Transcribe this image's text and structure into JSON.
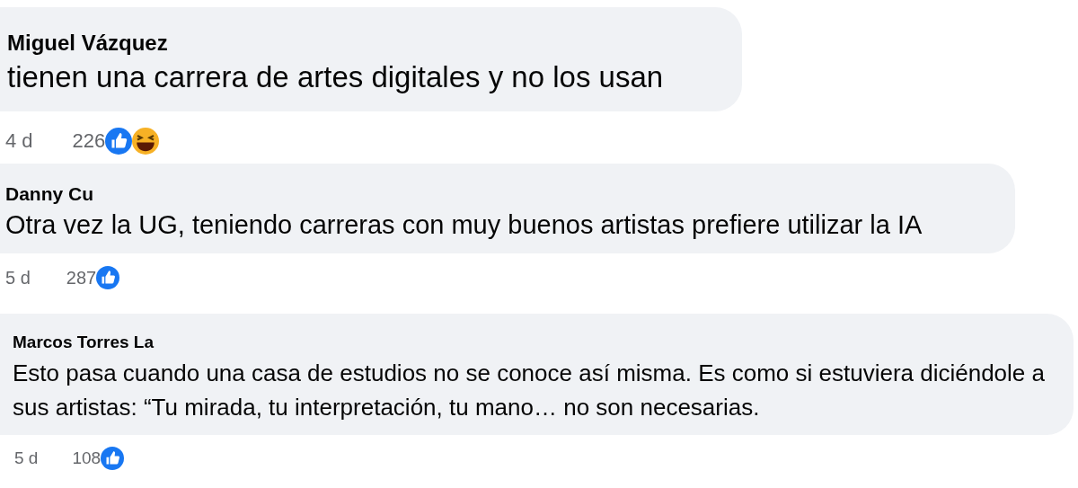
{
  "comments": [
    {
      "author": "Miguel Vázquez",
      "text": "tienen una carrera de artes digitales y no los usan",
      "time": "4 d",
      "count": "226",
      "reactions": [
        {
          "kind": "like"
        },
        {
          "kind": "haha"
        }
      ]
    },
    {
      "author": "Danny Cu",
      "text": "Otra vez la UG, teniendo carreras con muy buenos artistas prefiere utilizar la IA",
      "time": "5 d",
      "count": "287",
      "reactions": [
        {
          "kind": "like"
        }
      ]
    },
    {
      "author": "Marcos Torres La",
      "text": "Esto pasa cuando una casa de estudios no se conoce así misma. Es como si estuviera diciéndole a sus artistas: “Tu mirada, tu interpretación, tu mano… no son necesarias.",
      "time": "5 d",
      "count": "108",
      "reactions": [
        {
          "kind": "like"
        }
      ]
    }
  ]
}
